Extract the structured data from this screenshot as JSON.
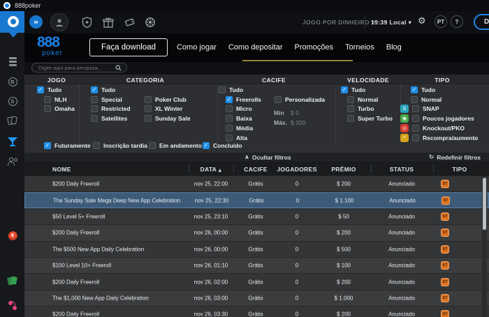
{
  "window": {
    "title": "888poker"
  },
  "sidebar": {
    "icons": [
      "lobby-stack-icon",
      "chip-icon",
      "snap-icon",
      "cash-games-icon",
      "tournaments-icon",
      "players-icon",
      "casino-icon",
      "blackjack-icon",
      "slots-icon"
    ],
    "active": "tournaments-icon"
  },
  "topbar": {
    "expand": "»",
    "icons": [
      "avatar-icon",
      "shield-icon",
      "gift-icon",
      "ticket-icon",
      "wheel-icon"
    ],
    "money_mode": "JOGO POR DINHEIRO",
    "time": "19:39 Local",
    "language": "PT",
    "help": "?",
    "deposit_visible": "D"
  },
  "nav": {
    "logo_main": "888",
    "logo_sub": "poker",
    "download_button": "Faça download",
    "links": [
      "Como jogar",
      "Como depositar",
      "Promoções",
      "Torneios",
      "Blog"
    ],
    "active_link": "Promoções"
  },
  "search": {
    "placeholder": "Digite aqui para pesquisa...",
    "icon": "search-icon"
  },
  "filters": {
    "titles": [
      "JOGO",
      "CATEGORIA",
      "CACIFE",
      "VELOCIDADE",
      "TIPO"
    ],
    "jogo": [
      {
        "label": "Tudo",
        "checked": true
      },
      {
        "label": "NLH",
        "checked": false
      },
      {
        "label": "Omaha",
        "checked": false
      }
    ],
    "categoria": [
      {
        "label": "Tudo",
        "checked": true
      },
      {
        "label": "Special",
        "checked": false
      },
      {
        "label": "Restricted",
        "checked": false
      },
      {
        "label": "Satellites",
        "checked": false
      },
      {
        "label": "Poker Club",
        "checked": false
      },
      {
        "label": "XL Winter",
        "checked": false
      },
      {
        "label": "Sunday Sale",
        "checked": false
      }
    ],
    "cacife": [
      {
        "label": "Tudo",
        "checked": false
      },
      {
        "label": "Freerolls",
        "checked": true
      },
      {
        "label": "Micro",
        "checked": false
      },
      {
        "label": "Baixa",
        "checked": false
      },
      {
        "label": "Média",
        "checked": false
      },
      {
        "label": "Alta",
        "checked": false
      },
      {
        "label": "Personalizada",
        "checked": false
      }
    ],
    "cacife_custom": {
      "min_label": "Min",
      "min_value": "$ 0",
      "max_label": "Máx.",
      "max_value": "$ 200"
    },
    "velocidade": [
      {
        "label": "Tudo",
        "checked": true
      },
      {
        "label": "Normal",
        "checked": false
      },
      {
        "label": "Turbo",
        "checked": false
      },
      {
        "label": "Super Turbo",
        "checked": false
      }
    ],
    "tipo": [
      {
        "label": "Tudo",
        "checked": true
      },
      {
        "label": "Normal",
        "checked": false
      },
      {
        "label": "SNAP",
        "checked": false,
        "icon": "S",
        "icon_color": "#2aa4bc"
      },
      {
        "label": "Poucos jogadores",
        "checked": false,
        "icon": "◉",
        "icon_color": "#49a94c"
      },
      {
        "label": "Knockout/PKO",
        "checked": false,
        "icon": "◎",
        "icon_color": "#d23b30"
      },
      {
        "label": "Recompra/aumento",
        "checked": false,
        "icon": "+",
        "icon_color": "#d9a41c"
      }
    ],
    "status_row": [
      {
        "label": "Futuramente",
        "checked": true
      },
      {
        "label": "Inscrição tardia",
        "checked": false
      },
      {
        "label": "Em andamento",
        "checked": false
      },
      {
        "label": "Concluído",
        "checked": true
      }
    ],
    "hide_filters": "Ocultar filtros",
    "reset_filters": "Redefinir filtros"
  },
  "table": {
    "columns": [
      "NOME",
      "DATA",
      "CACIFE",
      "JOGADORES",
      "PRÉMIO",
      "STATUS",
      "TIPO"
    ],
    "sort_column": "DATA",
    "type_badge": "ST",
    "type_badge_color": "#e0731f",
    "rows": [
      {
        "name": "$200 Daily Freeroll",
        "date": "nov 25, 22:00",
        "cacife": "Grátis",
        "players": "0",
        "prize": "$ 200",
        "status": "Anunciado",
        "selected": false
      },
      {
        "name": "The Sunday Sale Mega Deep New App Celebration",
        "date": "nov 25, 22:30",
        "cacife": "Grátis",
        "players": "0",
        "prize": "$ 1.100",
        "status": "Anunciado",
        "selected": true
      },
      {
        "name": "$50 Level 5+ Freeroll",
        "date": "nov 25, 23:10",
        "cacife": "Grátis",
        "players": "0",
        "prize": "$ 50",
        "status": "Anunciado",
        "selected": false
      },
      {
        "name": "$200 Daily Freeroll",
        "date": "nov 26, 00:00",
        "cacife": "Grátis",
        "players": "0",
        "prize": "$ 200",
        "status": "Anunciado",
        "selected": false
      },
      {
        "name": "The $500 New App Daily Celebration",
        "date": "nov 26, 00:00",
        "cacife": "Grátis",
        "players": "0",
        "prize": "$ 500",
        "status": "Anunciado",
        "selected": false
      },
      {
        "name": "$100 Level 10+ Freeroll",
        "date": "nov 26, 01:10",
        "cacife": "Grátis",
        "players": "0",
        "prize": "$ 100",
        "status": "Anunciado",
        "selected": false
      },
      {
        "name": "$200 Daily Freeroll",
        "date": "nov 26, 02:00",
        "cacife": "Grátis",
        "players": "0",
        "prize": "$ 200",
        "status": "Anunciado",
        "selected": false
      },
      {
        "name": "The $1,000 New App Daily Celebration",
        "date": "nov 26, 03:00",
        "cacife": "Grátis",
        "players": "0",
        "prize": "$ 1.000",
        "status": "Anunciado",
        "selected": false
      },
      {
        "name": "$200 Daily Freeroll",
        "date": "nov 26, 03:30",
        "cacife": "Grátis",
        "players": "0",
        "prize": "$ 200",
        "status": "Anunciado",
        "selected": false
      }
    ]
  },
  "colors": {
    "accent_blue": "#1f86e8",
    "selected_row": "#3d5b79",
    "gold_underline": "#9d8630",
    "checkbox_checked": "#1f8fe8"
  }
}
